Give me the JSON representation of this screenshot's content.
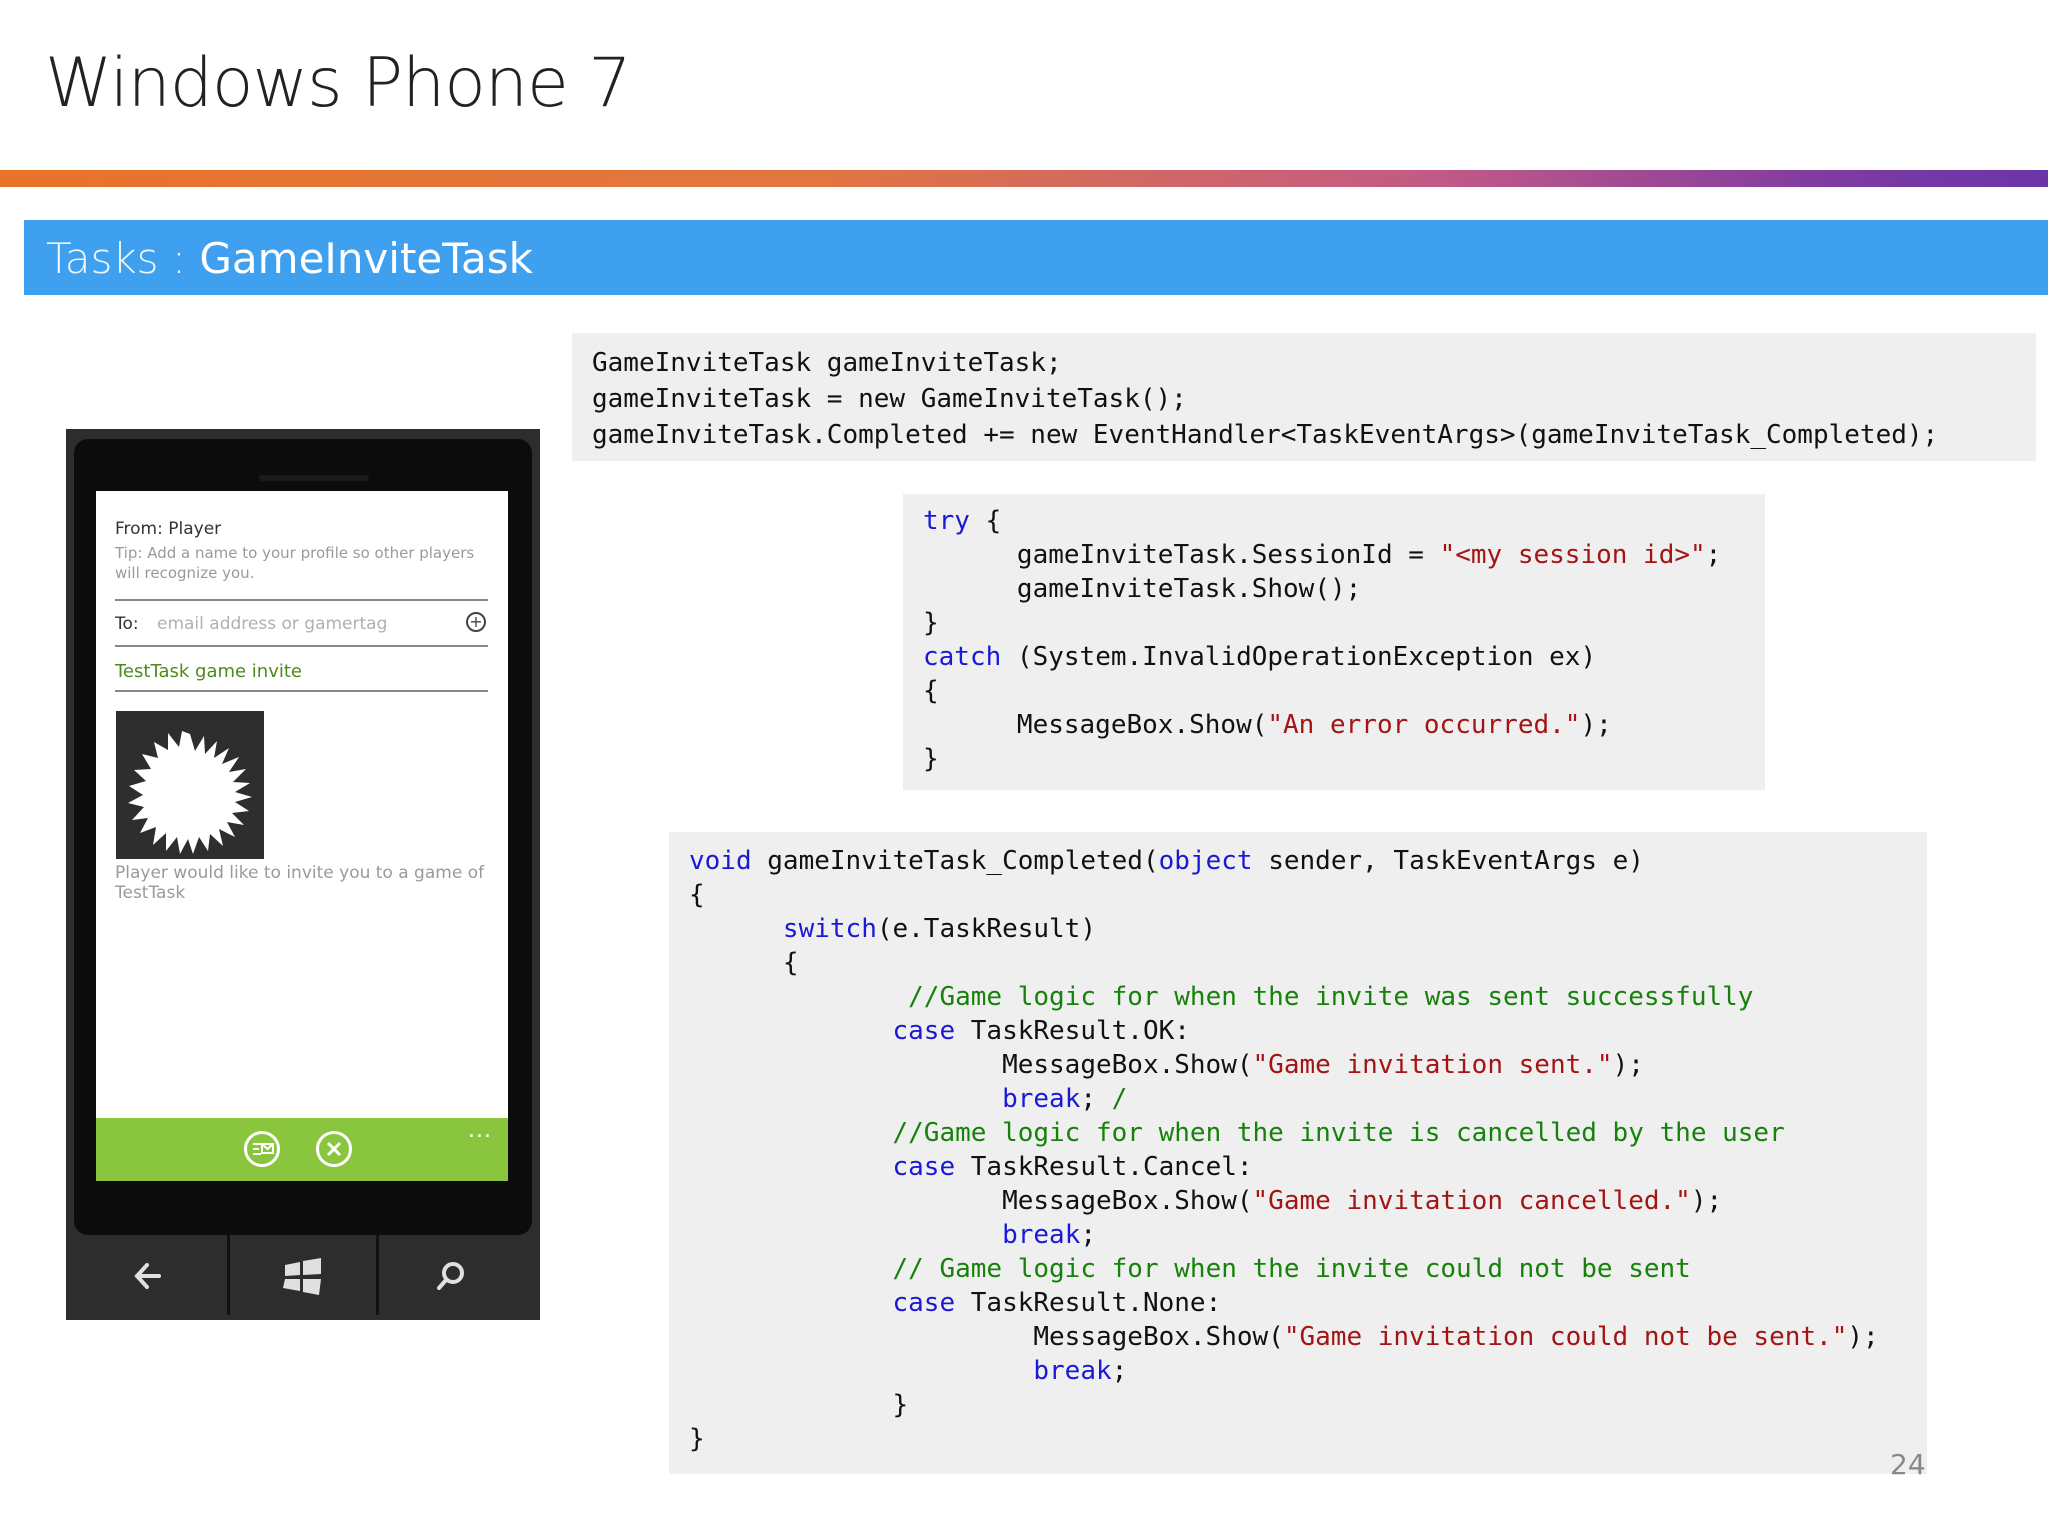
{
  "header": {
    "title": "Windows Phone 7"
  },
  "section": {
    "prefix": "Tasks : ",
    "name": "GameInviteTask"
  },
  "code1": [
    [
      {
        "t": "GameInviteTask gameInviteTask;"
      }
    ],
    [
      {
        "t": "gameInviteTask = new GameInviteTask();"
      }
    ],
    [
      {
        "t": "gameInviteTask.Completed += new EventHandler<TaskEventArgs>(gameInviteTask_Completed);"
      }
    ]
  ],
  "code2": [
    [
      {
        "t": "try",
        "c": "kw"
      },
      {
        "t": " {"
      }
    ],
    [
      {
        "t": "      gameInviteTask.SessionId = "
      },
      {
        "t": "\"<my session id>\"",
        "c": "str"
      },
      {
        "t": ";"
      }
    ],
    [
      {
        "t": "      gameInviteTask.Show();"
      }
    ],
    [
      {
        "t": "}"
      }
    ],
    [
      {
        "t": "catch",
        "c": "kw"
      },
      {
        "t": " (System.InvalidOperationException ex)"
      }
    ],
    [
      {
        "t": "{"
      }
    ],
    [
      {
        "t": "      MessageBox.Show("
      },
      {
        "t": "\"An error occurred.\"",
        "c": "str"
      },
      {
        "t": ");"
      }
    ],
    [
      {
        "t": "}"
      }
    ]
  ],
  "code3": [
    [
      {
        "t": "void",
        "c": "kw"
      },
      {
        "t": " gameInviteTask_Completed("
      },
      {
        "t": "object",
        "c": "kw"
      },
      {
        "t": " sender, TaskEventArgs e)"
      }
    ],
    [
      {
        "t": "{"
      }
    ],
    [
      {
        "t": "      "
      },
      {
        "t": "switch",
        "c": "kw"
      },
      {
        "t": "(e.TaskResult)"
      }
    ],
    [
      {
        "t": "      {"
      }
    ],
    [
      {
        "t": "              "
      },
      {
        "t": "//Game logic for when the invite was sent successfully",
        "c": "cm"
      }
    ],
    [
      {
        "t": "             "
      },
      {
        "t": "case",
        "c": "kw"
      },
      {
        "t": " TaskResult.OK:"
      }
    ],
    [
      {
        "t": "                    MessageBox.Show("
      },
      {
        "t": "\"Game invitation sent.\"",
        "c": "str"
      },
      {
        "t": ");"
      }
    ],
    [
      {
        "t": "                    "
      },
      {
        "t": "break",
        "c": "kw"
      },
      {
        "t": "; "
      },
      {
        "t": "/",
        "c": "cm"
      }
    ],
    [
      {
        "t": "             "
      },
      {
        "t": "//Game logic for when the invite is cancelled by the user",
        "c": "cm"
      }
    ],
    [
      {
        "t": "             "
      },
      {
        "t": "case",
        "c": "kw"
      },
      {
        "t": " TaskResult.Cancel:"
      }
    ],
    [
      {
        "t": "                    MessageBox.Show("
      },
      {
        "t": "\"Game invitation cancelled.\"",
        "c": "str"
      },
      {
        "t": ");"
      }
    ],
    [
      {
        "t": "                    "
      },
      {
        "t": "break",
        "c": "kw"
      },
      {
        "t": ";"
      }
    ],
    [
      {
        "t": "             "
      },
      {
        "t": "// Game logic for when the invite could not be sent",
        "c": "cm"
      }
    ],
    [
      {
        "t": "             "
      },
      {
        "t": "case",
        "c": "kw"
      },
      {
        "t": " TaskResult.None:"
      }
    ],
    [
      {
        "t": "                      MessageBox.Show("
      },
      {
        "t": "\"Game invitation could not be sent.\"",
        "c": "str"
      },
      {
        "t": ");"
      }
    ],
    [
      {
        "t": "                      "
      },
      {
        "t": "break",
        "c": "kw"
      },
      {
        "t": ";"
      }
    ],
    [
      {
        "t": "             }"
      }
    ],
    [
      {
        "t": "}"
      }
    ]
  ],
  "phone": {
    "from": "From: Player",
    "tip": "Tip: Add a name to your profile so other players will recognize you.",
    "to_label": "To:",
    "to_placeholder": "email address or gamertag",
    "subject": "TestTask game invite",
    "body": "Player would like to invite you to a game of TestTask",
    "appbar_dots": "...",
    "colors": {
      "accent": "#8ac53e",
      "section": "#3ea0ee"
    },
    "icons": [
      "send-icon",
      "cancel-icon",
      "back-icon",
      "windows-icon",
      "search-icon"
    ]
  },
  "page_number": "24"
}
